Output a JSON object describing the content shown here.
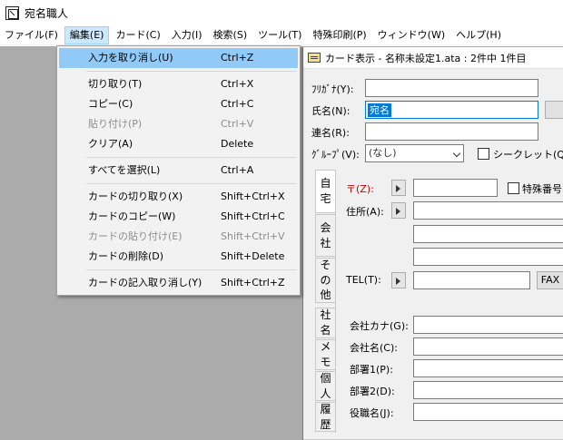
{
  "app": {
    "title": "宛名職人"
  },
  "menubar": [
    {
      "label": "ファイル(F)",
      "active": false
    },
    {
      "label": "編集(E)",
      "active": true
    },
    {
      "label": "カード(C)",
      "active": false
    },
    {
      "label": "入力(I)",
      "active": false
    },
    {
      "label": "検索(S)",
      "active": false
    },
    {
      "label": "ツール(T)",
      "active": false
    },
    {
      "label": "特殊印刷(P)",
      "active": false
    },
    {
      "label": "ウィンドウ(W)",
      "active": false
    },
    {
      "label": "ヘルプ(H)",
      "active": false
    }
  ],
  "edit_menu": {
    "undo": {
      "label": "入力を取り消し(U)",
      "shortcut": "Ctrl+Z"
    },
    "cut": {
      "label": "切り取り(T)",
      "shortcut": "Ctrl+X"
    },
    "copy": {
      "label": "コピー(C)",
      "shortcut": "Ctrl+C"
    },
    "paste": {
      "label": "貼り付け(P)",
      "shortcut": "Ctrl+V"
    },
    "clear": {
      "label": "クリア(A)",
      "shortcut": "Delete"
    },
    "select_all": {
      "label": "すべてを選択(L)",
      "shortcut": "Ctrl+A"
    },
    "card_cut": {
      "label": "カードの切り取り(X)",
      "shortcut": "Shift+Ctrl+X"
    },
    "card_copy": {
      "label": "カードのコピー(W)",
      "shortcut": "Shift+Ctrl+C"
    },
    "card_paste": {
      "label": "カードの貼り付け(E)",
      "shortcut": "Shift+Ctrl+V"
    },
    "card_delete": {
      "label": "カードの削除(D)",
      "shortcut": "Shift+Delete"
    },
    "card_undo": {
      "label": "カードの記入取り消し(Y)",
      "shortcut": "Shift+Ctrl+Z"
    }
  },
  "card_window": {
    "title": "カード表示 - 名称未設定1.ata : 2件中 1件目",
    "furigana_label": "ﾌﾘｶﾞﾅ(Y):",
    "name_label": "氏名(N):",
    "name_value": "宛名",
    "joint_name_label": "連名(R):",
    "group_label": "ｸﾞﾙｰﾌﾟ(V):",
    "group_value": "(なし)",
    "secret_label": "シークレット(Q)",
    "postal_label": "〒(Z):",
    "special_number_label": "特殊番号",
    "address_label": "住所(A):",
    "tel_label": "TEL(T):",
    "fax_label": "FAX",
    "company_kana_label": "会社カナ(G):",
    "company_name_label": "会社名(C):",
    "dept1_label": "部署1(P):",
    "dept2_label": "部署2(D):",
    "title_label": "役職名(J):",
    "tabs": {
      "home": [
        "自",
        "宅"
      ],
      "company": [
        "会",
        "社"
      ],
      "other": [
        "そ",
        "の",
        "他"
      ],
      "company_name": [
        "社",
        "名"
      ],
      "memo": [
        "メ",
        "モ"
      ],
      "personal": [
        "個",
        "人"
      ],
      "history": [
        "履",
        "歴"
      ]
    }
  },
  "colors": {
    "postal_mark": "#c00000",
    "menu_highlight": "#91c9f7",
    "selection": "#0078d7"
  }
}
